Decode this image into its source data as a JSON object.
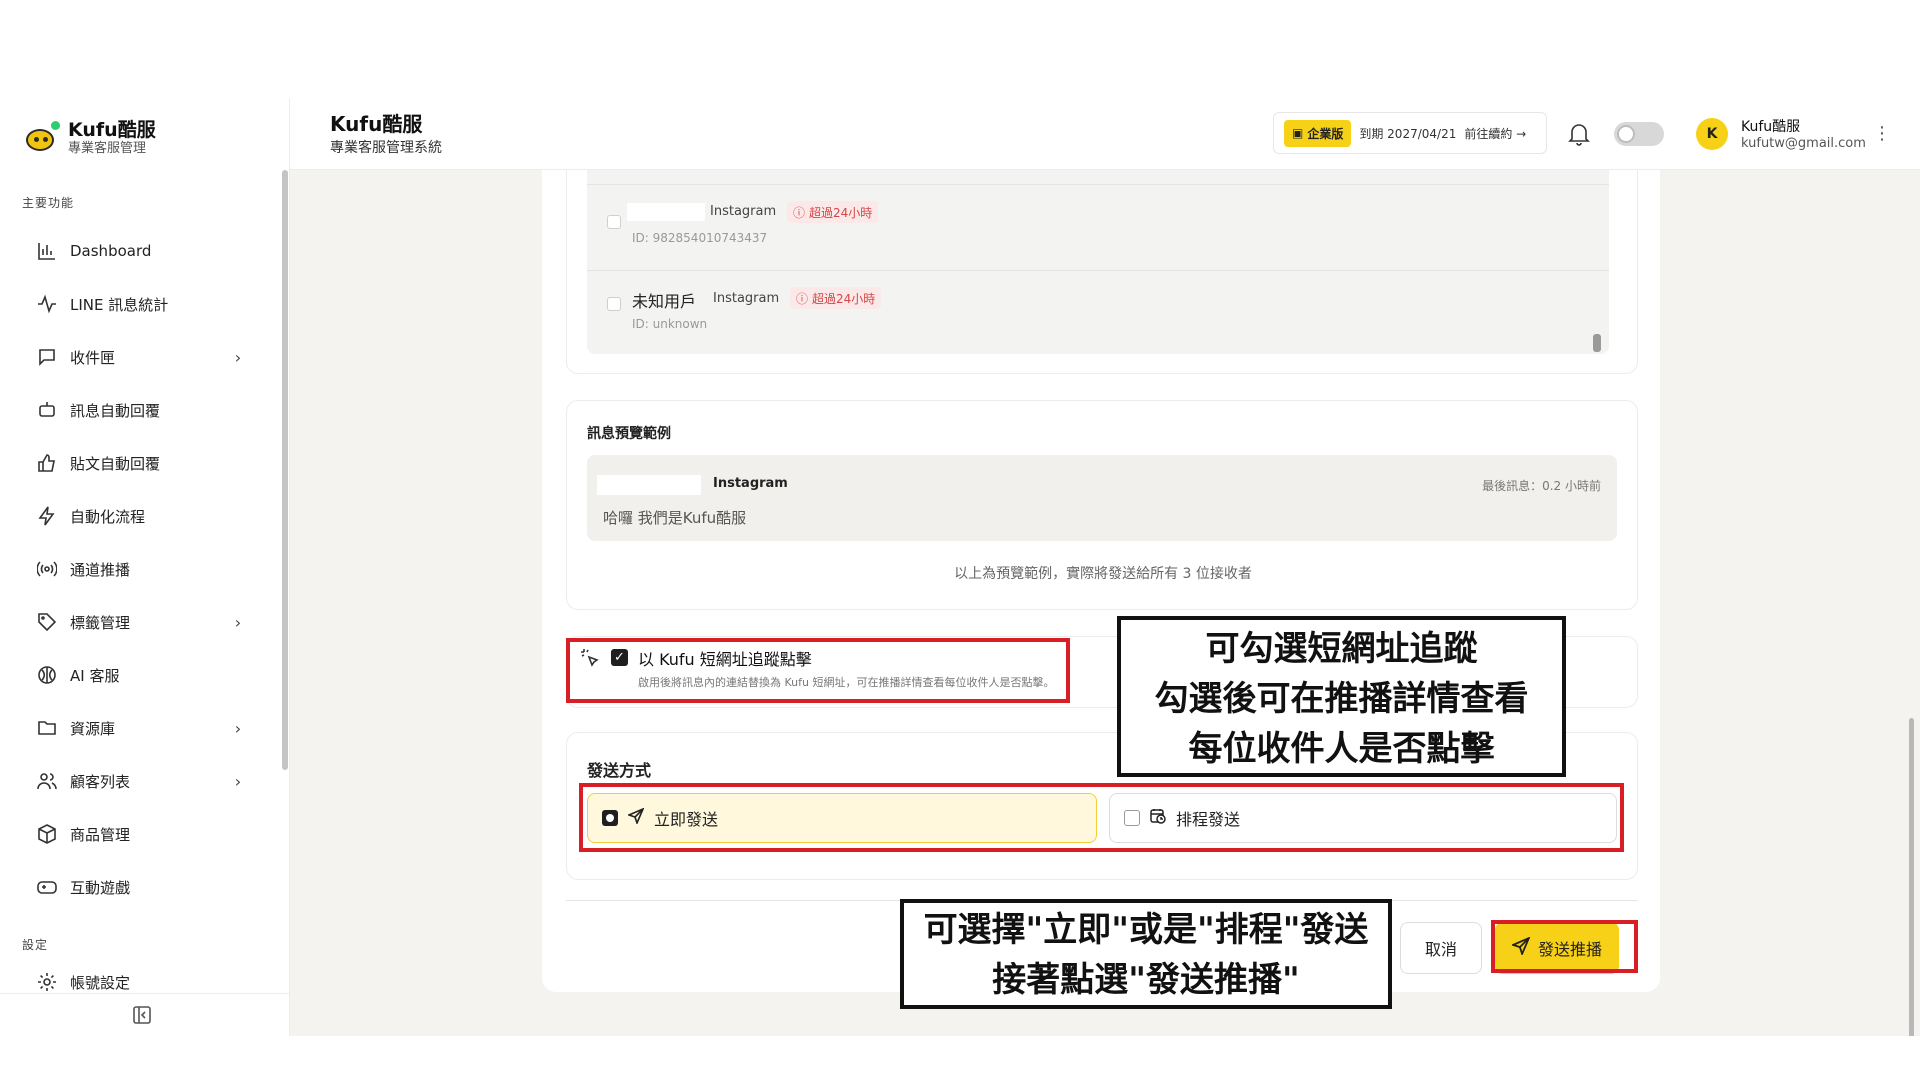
{
  "brand": {
    "name": "Kufu酷服",
    "subtitle": "專業客服管理"
  },
  "sidebar": {
    "section_main": "主要功能",
    "items": [
      {
        "label": "Dashboard",
        "icon": "bar-chart-icon",
        "has_chevron": false
      },
      {
        "label": "LINE 訊息統計",
        "icon": "activity-icon",
        "has_chevron": false
      },
      {
        "label": "收件匣",
        "icon": "message-square-icon",
        "has_chevron": true
      },
      {
        "label": "訊息自動回覆",
        "icon": "bot-icon",
        "has_chevron": false
      },
      {
        "label": "貼文自動回覆",
        "icon": "thumbs-up-icon",
        "has_chevron": false
      },
      {
        "label": "自動化流程",
        "icon": "lightning-icon",
        "has_chevron": false
      },
      {
        "label": "通道推播",
        "icon": "broadcast-icon",
        "has_chevron": false
      },
      {
        "label": "標籤管理",
        "icon": "tag-icon",
        "has_chevron": true
      },
      {
        "label": "AI 客服",
        "icon": "ai-icon",
        "has_chevron": false
      },
      {
        "label": "資源庫",
        "icon": "folder-icon",
        "has_chevron": true
      },
      {
        "label": "顧客列表",
        "icon": "users-icon",
        "has_chevron": true
      },
      {
        "label": "商品管理",
        "icon": "package-icon",
        "has_chevron": false
      },
      {
        "label": "互動遊戲",
        "icon": "gamepad-icon",
        "has_chevron": false
      }
    ],
    "section_settings": "設定",
    "settings_items": [
      {
        "label": "帳號設定",
        "icon": "gear-icon"
      }
    ]
  },
  "header": {
    "title": "Kufu酷服",
    "subtitle": "專業客服管理系統",
    "plan_badge": "企業版",
    "expiry": "到期 2027/04/21",
    "renew_link": "前往續約 →",
    "user_initial": "K",
    "user_name": "Kufu酷服",
    "user_email": "kufutw@gmail.com"
  },
  "recipients": [
    {
      "name": "",
      "platform": "Instagram",
      "status": "超過24小時",
      "id": "ID: 982854010743437"
    },
    {
      "name": "未知用戶",
      "platform": "Instagram",
      "status": "超過24小時",
      "id": "ID: unknown"
    }
  ],
  "preview": {
    "title": "訊息預覽範例",
    "sender_name": "",
    "platform": "Instagram",
    "last_message": "最後訊息：0.2 小時前",
    "message": "哈囉 我們是Kufu酷服",
    "note": "以上為預覽範例，實際將發送給所有 3 位接收者"
  },
  "tracking": {
    "label": "以 Kufu 短網址追蹤點擊",
    "description": "啟用後將訊息內的連結替換為 Kufu 短網址，可在推播詳情查看每位收件人是否點擊。",
    "checked": true
  },
  "send_method": {
    "title": "發送方式",
    "options": [
      {
        "label": "立即發送",
        "selected": true
      },
      {
        "label": "排程發送",
        "selected": false
      }
    ]
  },
  "actions": {
    "cancel": "取消",
    "submit": "發送推播"
  },
  "annotations": {
    "callout1": [
      "可勾選短網址追蹤",
      "勾選後可在推播詳情查看",
      "每位收件人是否點擊"
    ],
    "callout2": [
      "可選擇\"立即\"或是\"排程\"發送",
      "接著點選\"發送推播\""
    ]
  },
  "colors": {
    "accent": "#f7d117",
    "annotation_red": "#d81f26",
    "warning": "#d64545"
  }
}
